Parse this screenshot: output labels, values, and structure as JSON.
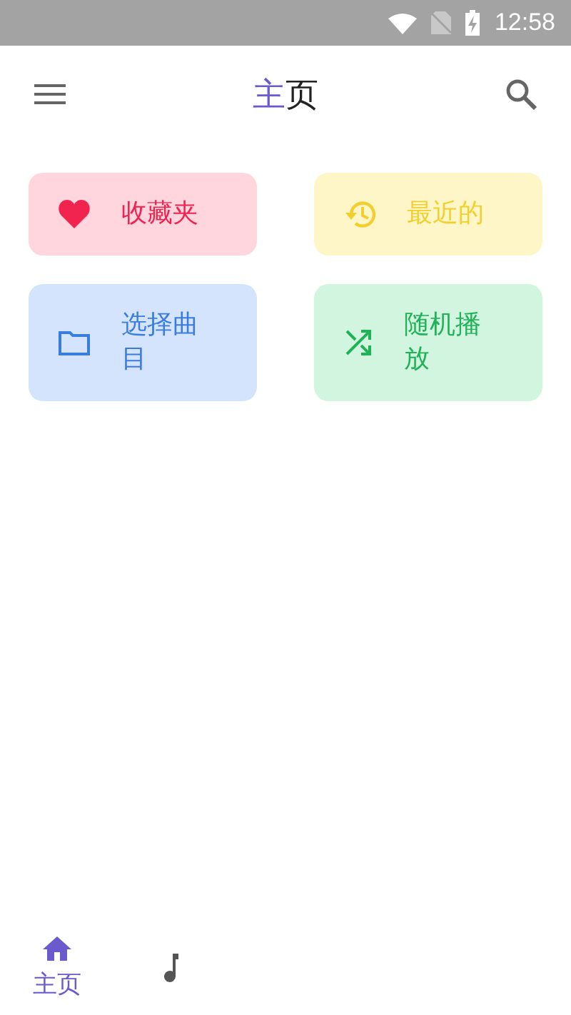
{
  "status_bar": {
    "time": "12:58"
  },
  "app_bar": {
    "title_parts": [
      {
        "text": "主",
        "accent": true
      },
      {
        "text": "页",
        "accent": false
      }
    ]
  },
  "cards": [
    {
      "kind": "favorites",
      "label": "收藏夹",
      "color": "#f0244f"
    },
    {
      "kind": "recent",
      "label": "最近的",
      "color": "#f2cf2e"
    },
    {
      "kind": "folder",
      "label": "选择曲目",
      "color": "#3a7de0"
    },
    {
      "kind": "shuffle",
      "label": "随机播放",
      "color": "#1fb257"
    }
  ],
  "bottom_nav": [
    {
      "kind": "home",
      "label": "主页",
      "selected": true
    },
    {
      "kind": "music",
      "selected": false
    }
  ]
}
